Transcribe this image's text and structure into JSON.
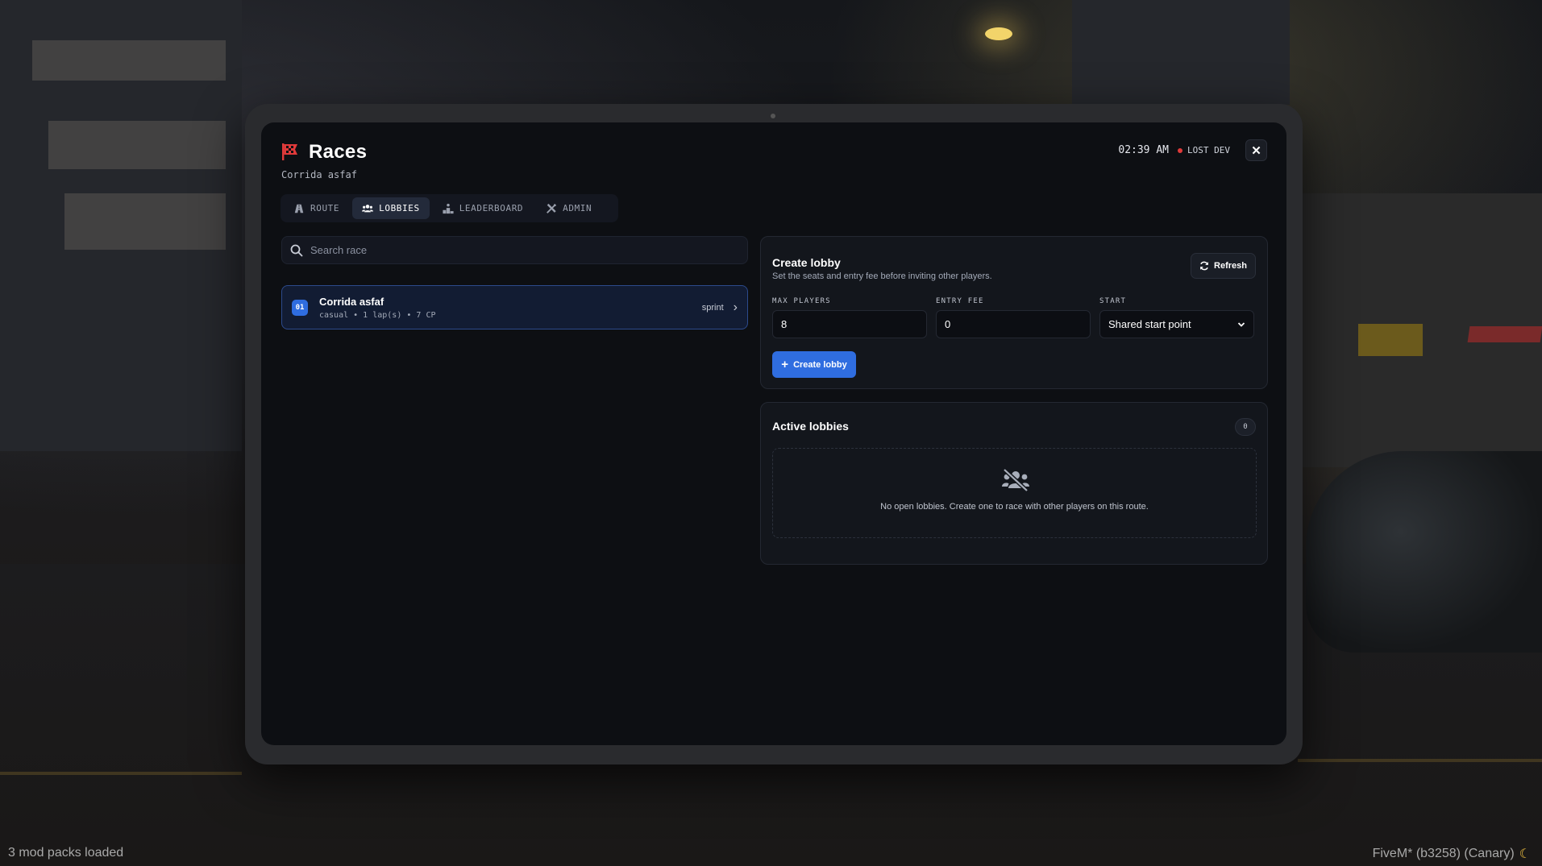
{
  "header": {
    "title": "Races",
    "subtitle": "Corrida asfaf",
    "time": "02:39 AM",
    "status": "LOST DEV"
  },
  "tabs": [
    {
      "label": "ROUTE",
      "icon": "road-icon",
      "active": false
    },
    {
      "label": "LOBBIES",
      "icon": "users-icon",
      "active": true
    },
    {
      "label": "LEADERBOARD",
      "icon": "podium-icon",
      "active": false
    },
    {
      "label": "ADMIN",
      "icon": "tools-icon",
      "active": false
    }
  ],
  "search": {
    "placeholder": "Search race"
  },
  "races": [
    {
      "number": "01",
      "name": "Corrida asfaf",
      "meta": "casual • 1 lap(s) • 7 CP",
      "type": "sprint"
    }
  ],
  "create_lobby": {
    "title": "Create lobby",
    "description": "Set the seats and entry fee before inviting other players.",
    "refresh_label": "Refresh",
    "max_players_label": "MAX PLAYERS",
    "max_players_value": "8",
    "entry_fee_label": "ENTRY FEE",
    "entry_fee_value": "0",
    "start_label": "START",
    "start_value": "Shared start point",
    "button_label": "Create lobby"
  },
  "active_lobbies": {
    "title": "Active lobbies",
    "count": "0",
    "empty_text": "No open lobbies. Create one to race with other players on this route."
  },
  "footer": {
    "left": "3 mod packs loaded",
    "right": "FiveM* (b3258) (Canary)"
  },
  "colors": {
    "accent": "#2f6de0",
    "flag": "#e03a3a",
    "status_dot": "#e03a3a",
    "panel_bg": "#13161c",
    "screen_bg": "#0d0f13"
  }
}
